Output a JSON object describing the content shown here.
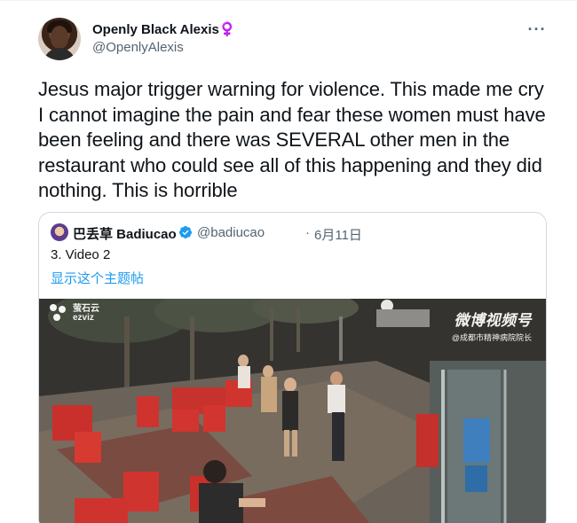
{
  "tweet": {
    "display_name": "Openly Black Alexis♀️",
    "handle": "@OpenlyAlexis",
    "more_icon": "more-dots-icon",
    "text": "Jesus major trigger warning for violence. This made me cry I cannot imagine the pain and fear these women must have been feeling and there was SEVERAL other men in the restaurant who could see all of this happening and they did nothing. This is horrible"
  },
  "quote": {
    "display_name": "巴丢草 Badiucao",
    "verified_icon": "verified-badge-icon",
    "handle": "@badiucao",
    "separator": "·",
    "date": "6月11日",
    "text": "3. Video 2",
    "thread_link": "显示这个主题帖"
  },
  "video": {
    "watermark_left": "萤石云",
    "watermark_left_sub": "ezviz",
    "watermark_right": "微博视频号",
    "watermark_right_sub": "@成都市精神病院院长"
  },
  "colors": {
    "text_primary": "#0f1419",
    "text_secondary": "#536471",
    "link": "#1d9bf0",
    "border": "#cfd9de"
  }
}
